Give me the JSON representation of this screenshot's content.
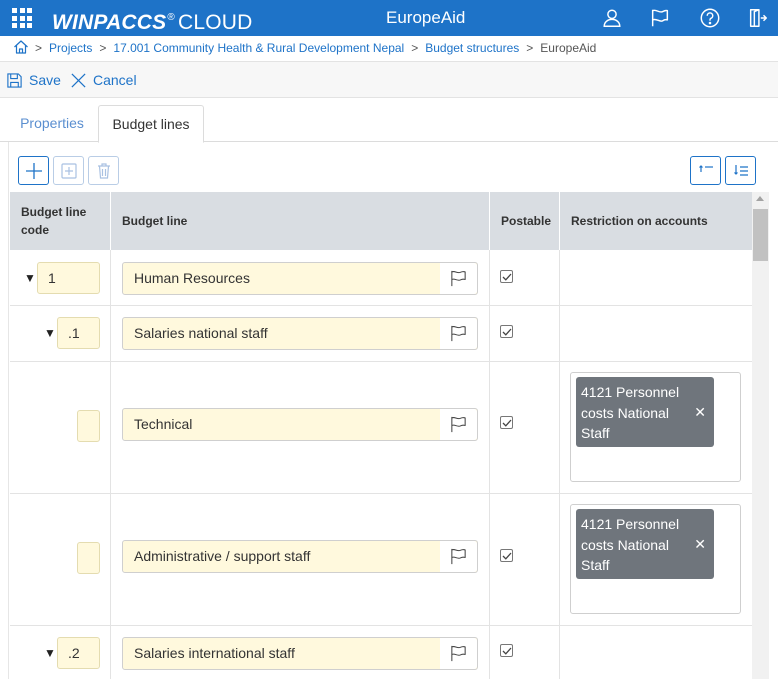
{
  "header": {
    "brand_bold": "WINPACCS",
    "brand_reg": "®",
    "brand_light": "CLOUD",
    "center_title": "EuropeAid"
  },
  "breadcrumb": {
    "items": [
      "Projects",
      "17.001 Community Health & Rural Development Nepal",
      "Budget structures"
    ],
    "current": "EuropeAid",
    "separator": ">"
  },
  "toolbar": {
    "save_label": "Save",
    "cancel_label": "Cancel"
  },
  "tabs": [
    {
      "label": "Properties",
      "active": false
    },
    {
      "label": "Budget lines",
      "active": true
    }
  ],
  "grid": {
    "headers": {
      "code": "Budget line code",
      "name": "Budget line",
      "postable": "Postable",
      "restriction": "Restriction on accounts"
    },
    "rows": [
      {
        "caret": "▼",
        "code": "1",
        "name": "Human Resources",
        "postable": true,
        "restriction": null
      },
      {
        "caret": "▼",
        "code": ".1",
        "name": "Salaries national staff",
        "postable": true,
        "restriction": null
      },
      {
        "caret": "",
        "code": "",
        "name": "Technical",
        "postable": true,
        "restriction": "4121 Personnel costs National Staff"
      },
      {
        "caret": "",
        "code": "",
        "name": "Administrative / support staff",
        "postable": true,
        "restriction": "4121 Personnel costs National Staff"
      },
      {
        "caret": "▼",
        "code": ".2",
        "name": "Salaries international staff",
        "postable": true,
        "restriction": null
      }
    ]
  },
  "tag_remove_glyph": "✕",
  "colors": {
    "brand": "#1e73c8",
    "input_bg": "#fff9dd",
    "tag_bg": "#6f757c",
    "header_bg": "#d9dde2"
  },
  "icons": [
    "apps-grid-icon",
    "user-icon",
    "flag-icon",
    "help-icon",
    "logout-icon",
    "home-icon",
    "save-icon",
    "cancel-icon",
    "add-icon",
    "add-child-icon",
    "delete-icon",
    "collapse-all-icon",
    "expand-all-icon"
  ]
}
